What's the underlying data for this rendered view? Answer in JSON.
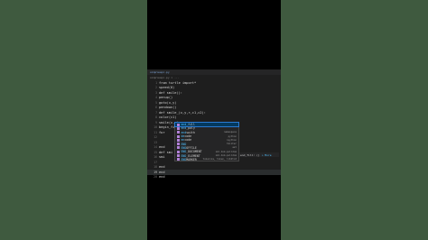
{
  "tab": {
    "label": "simpleapi.py"
  },
  "breadcrumb": "simpleapi.py > ...",
  "lines": [
    {
      "num": "1",
      "code": "from turtle import*"
    },
    {
      "num": "2",
      "code": "speed(0)"
    },
    {
      "num": "3",
      "code": "def smile():"
    },
    {
      "num": "4",
      "code": "    penup()"
    },
    {
      "num": "5",
      "code": "    goto(x,y)"
    },
    {
      "num": "6",
      "code": "    pendown()"
    },
    {
      "num": "7",
      "code": "def smile_(x,y,r,c1,c2):"
    },
    {
      "num": "8",
      "code": "    color(c1)"
    },
    {
      "num": "9",
      "code": "    smile(x,y)"
    },
    {
      "num": "10",
      "code": "    begin_fill()"
    },
    {
      "num": "11",
      "code": "    for"
    },
    {
      "num": "12",
      "code": ""
    },
    {
      "num": "13",
      "code": ""
    },
    {
      "num": "14",
      "code": "    end"
    },
    {
      "num": "15",
      "code": "def smi"
    },
    {
      "num": "16",
      "code": "    smi"
    },
    {
      "num": "17",
      "code": ""
    },
    {
      "num": "18",
      "code": "    end"
    },
    {
      "num": "19",
      "code": "    end"
    },
    {
      "num": "20",
      "code": "end"
    }
  ],
  "active_line": 19,
  "suggestions": [
    {
      "label": "end_fill",
      "match": "end",
      "detail": "",
      "selected": true
    },
    {
      "label": "end_poly",
      "match": "end",
      "detail": "",
      "selected": false
    },
    {
      "label": "endswith",
      "match": "end",
      "detail": "namespace",
      "selected": false
    },
    {
      "label": "decode",
      "match": "de",
      "detail": "python",
      "selected": false
    },
    {
      "label": "encode",
      "match": "en",
      "detail": "ipython",
      "selected": false
    },
    {
      "label": "END",
      "match": "END",
      "detail": "tkinter",
      "selected": false
    },
    {
      "label": "ENDOFFILE",
      "match": "END",
      "detail": "ast",
      "selected": false
    },
    {
      "label": "END_DOCUMENT",
      "match": "END",
      "detail": "xml.dom.pulldom",
      "selected": false
    },
    {
      "label": "END_ELEMENT",
      "match": "END",
      "detail": "xml.dom.pulldom",
      "selected": false
    },
    {
      "label": "ENDMARKER",
      "match": "END",
      "detail": "tokenize, token, lib2to3",
      "selected": false
    }
  ],
  "signature_hint": {
    "text": "end_fill: ()",
    "more": "» More"
  }
}
